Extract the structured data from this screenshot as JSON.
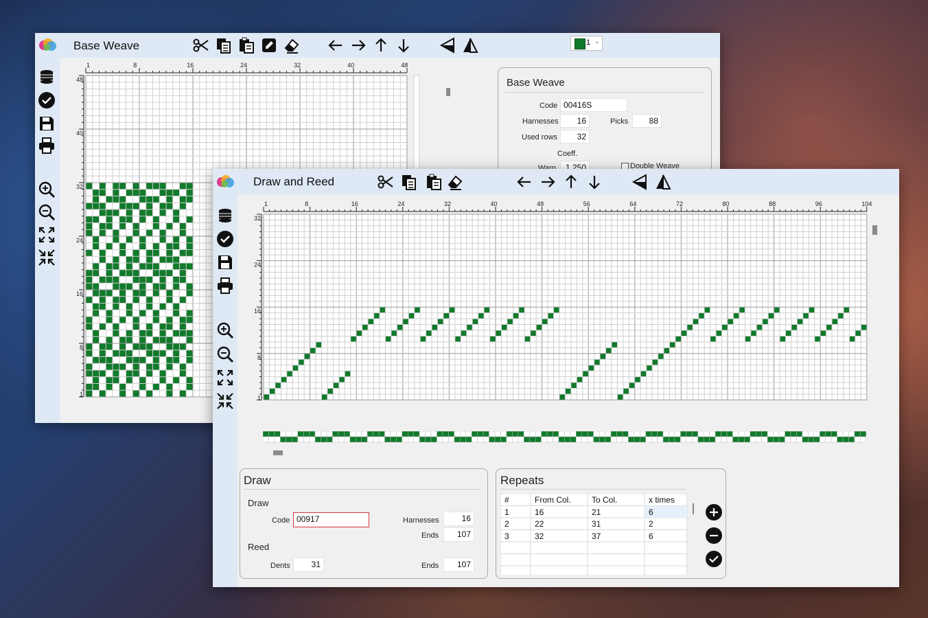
{
  "colors": {
    "weave_green": "#117a2b",
    "grid_line": "#cfcfcf",
    "grid_major": "#9a9a9a",
    "titlebar": "#dfe9f5",
    "window_bg": "#f0f0f0",
    "code_border_active": "#d9363e"
  },
  "base_window": {
    "title": "Base Weave",
    "toolbar_icons": [
      "scissors-icon",
      "copy-icon",
      "paste-icon",
      "pencil-box-icon",
      "eraser-icon",
      "arrow-left-icon",
      "arrow-right-icon",
      "arrow-up-icon",
      "arrow-down-icon",
      "flip-vertical-icon",
      "flip-horizontal-icon"
    ],
    "color_select": {
      "swatch_color": "#117a2b",
      "value": "1"
    },
    "sidebar_icons": [
      "coins-icon",
      "check-circle-icon",
      "save-icon",
      "print-icon",
      "zoom-in-icon",
      "zoom-out-icon",
      "expand-icon",
      "collapse-icon"
    ],
    "x_ticks": [
      "1",
      "8",
      "16",
      "24",
      "32",
      "40",
      "48"
    ],
    "y_ticks": [
      "48",
      "40",
      "32",
      "24",
      "16",
      "8",
      "1"
    ],
    "panel": {
      "title": "Base Weave",
      "code_label": "Code",
      "code_value": "00416S",
      "harnesses_label": "Harnesses",
      "harnesses_value": "16",
      "picks_label": "Picks",
      "picks_value": "88",
      "used_rows_label": "Used rows",
      "used_rows_value": "32",
      "coeff_label": "Coeff.",
      "warp_label": "Warp",
      "warp_value": "1.250",
      "double_weave_label": "Double Weave"
    }
  },
  "draw_window": {
    "title": "Draw and Reed",
    "toolbar_icons": [
      "scissors-icon",
      "copy-icon",
      "paste-icon",
      "eraser-icon",
      "arrow-left-icon",
      "arrow-right-icon",
      "arrow-up-icon",
      "arrow-down-icon",
      "flip-vertical-icon",
      "flip-horizontal-icon"
    ],
    "sidebar_icons": [
      "coins-icon",
      "check-circle-icon",
      "save-icon",
      "print-icon",
      "zoom-in-icon",
      "zoom-out-icon",
      "expand-icon",
      "collapse-icon"
    ],
    "x_ticks": [
      "1",
      "8",
      "16",
      "24",
      "32",
      "40",
      "48",
      "56",
      "64",
      "72",
      "80",
      "88",
      "96",
      "104"
    ],
    "y_ticks": [
      "32",
      "24",
      "16",
      "8",
      "1"
    ],
    "draw_panel": {
      "title": "Draw",
      "draw_section": "Draw",
      "code_label": "Code",
      "code_value": "00917",
      "harnesses_label": "Harnesses",
      "harnesses_value": "16",
      "ends_label": "Ends",
      "ends_value": "107",
      "reed_section": "Reed",
      "dents_label": "Dents",
      "dents_value": "31",
      "reed_ends_label": "Ends",
      "reed_ends_value": "107"
    },
    "repeats_panel": {
      "title": "Repeats",
      "columns": [
        "#",
        "From Col.",
        "To Col.",
        "x times"
      ],
      "rows": [
        [
          "1",
          "16",
          "21",
          "6"
        ],
        [
          "2",
          "22",
          "31",
          "2"
        ],
        [
          "3",
          "32",
          "37",
          "6"
        ]
      ],
      "buttons": [
        "plus-circle-icon",
        "minus-circle-icon",
        "check-circle-icon"
      ]
    }
  }
}
